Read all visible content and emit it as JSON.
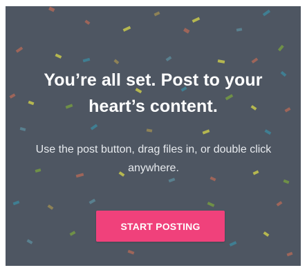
{
  "onboarding": {
    "headline": "You’re all set. Post to your heart’s content.",
    "description": "Use the post button, drag files in, or double click anywhere.",
    "cta_label": "START POSTING"
  },
  "colors": {
    "panel_background": "#4e5662",
    "cta_background": "#f0417b",
    "cta_text": "#ffffff",
    "headline_text": "#ffffff",
    "body_text": "#e7eaee",
    "confetti": [
      "#d8d84a",
      "#3b8ca2",
      "#b96a57",
      "#7aa43f",
      "#a49152",
      "#5d8e9e"
    ]
  }
}
